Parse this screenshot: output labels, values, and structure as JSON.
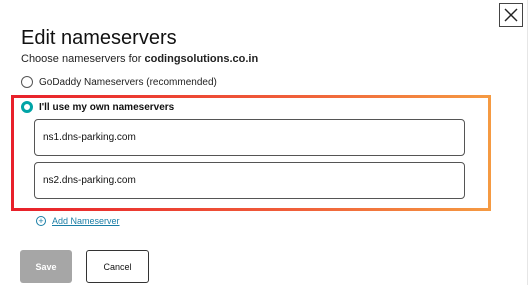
{
  "dialog": {
    "title": "Edit nameservers",
    "subtitle_prefix": "Choose nameservers for ",
    "domain": "codingsolutions.co.in",
    "close_icon": "close-icon"
  },
  "options": [
    {
      "label": "GoDaddy Nameservers (recommended)",
      "selected": false
    },
    {
      "label": "I'll use my own nameservers",
      "selected": true
    }
  ],
  "nameservers": [
    {
      "value": "ns1.dns-parking.com"
    },
    {
      "value": "ns2.dns-parking.com"
    }
  ],
  "add_nameserver": {
    "label": "Add Nameserver",
    "icon": "plus-circle-icon"
  },
  "buttons": {
    "save_label": "Save",
    "cancel_label": "Cancel"
  },
  "colors": {
    "accent": "#00a4a6",
    "link": "#1a7ea6",
    "highlight_start": "#e8202a",
    "highlight_end": "#f59a42",
    "save_disabled": "#a6a6a6"
  }
}
